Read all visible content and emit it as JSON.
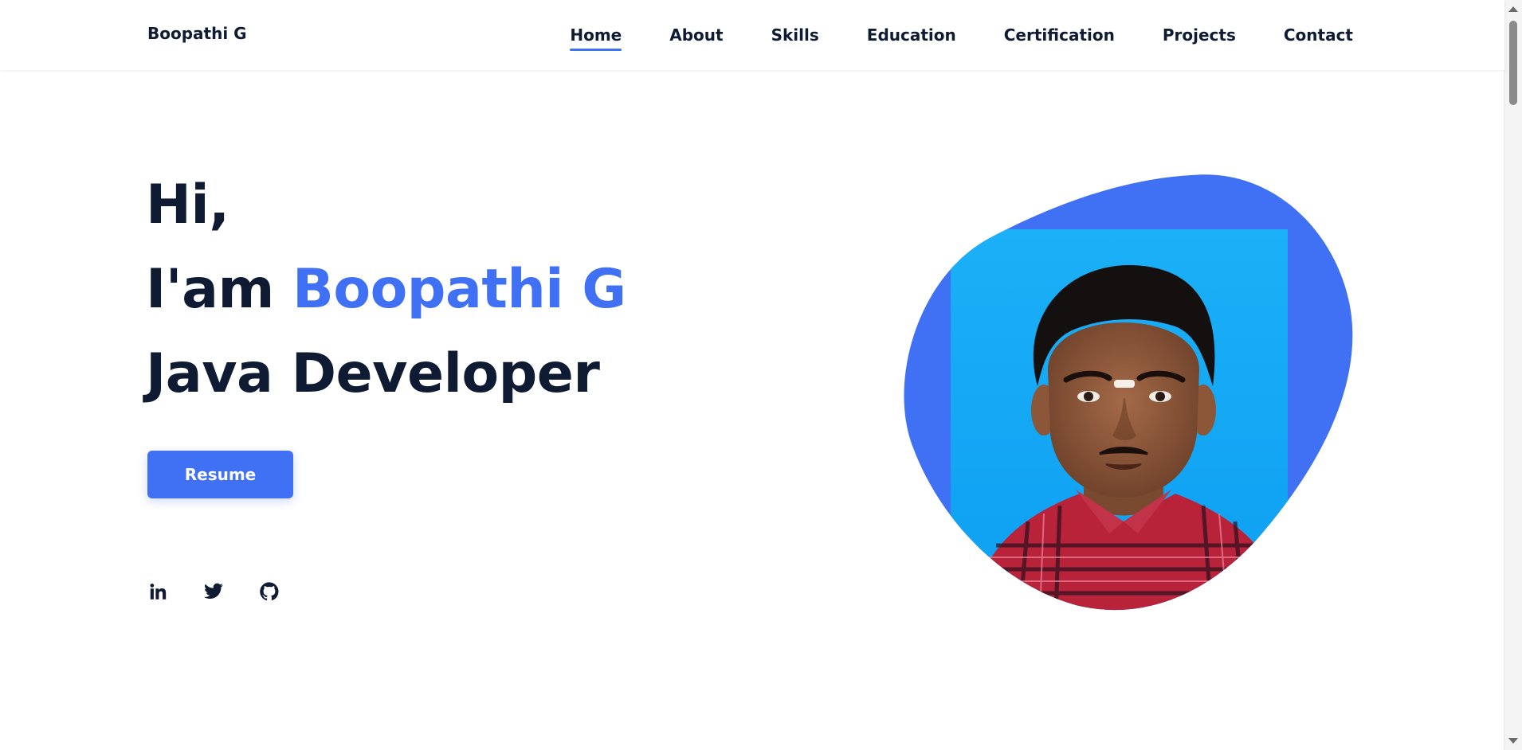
{
  "brand": "Boopathi G",
  "nav": [
    {
      "label": "Home",
      "active": true
    },
    {
      "label": "About",
      "active": false
    },
    {
      "label": "Skills",
      "active": false
    },
    {
      "label": "Education",
      "active": false
    },
    {
      "label": "Certification",
      "active": false
    },
    {
      "label": "Projects",
      "active": false
    },
    {
      "label": "Contact",
      "active": false
    }
  ],
  "hero": {
    "greeting": "Hi,",
    "intro_prefix": "I'am ",
    "name": "Boopathi G",
    "role": "Java Developer",
    "resume_label": "Resume"
  },
  "socials": [
    {
      "icon": "linkedin-icon"
    },
    {
      "icon": "twitter-icon"
    },
    {
      "icon": "github-icon"
    }
  ],
  "colors": {
    "accent": "#4070f4",
    "text": "#0f1a33",
    "photo_background": "#17a8f5"
  }
}
